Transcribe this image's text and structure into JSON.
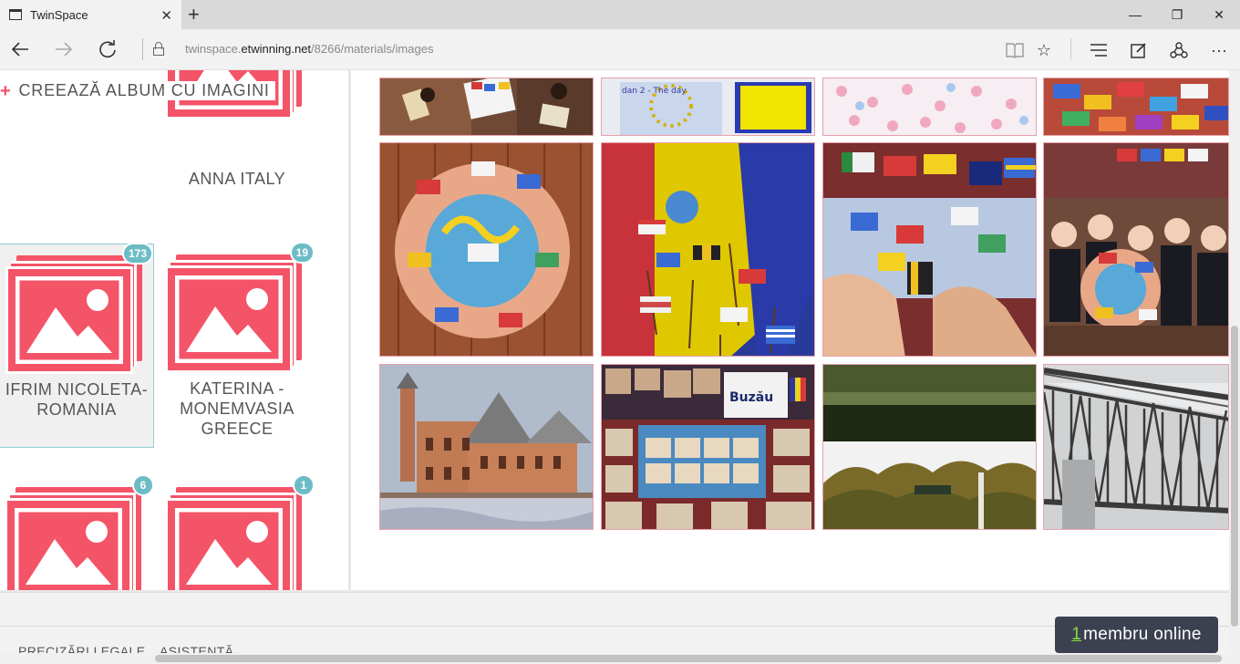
{
  "browser": {
    "tab_title": "TwinSpace",
    "url_prefix": "twinspace.",
    "url_host": "etwinning.net",
    "url_path": "/8266/materials/images",
    "icons": [
      "tab-icon",
      "close-icon",
      "new-tab-icon",
      "minimize-icon",
      "maximize-icon",
      "close-window-icon",
      "back-icon",
      "forward-icon",
      "refresh-icon",
      "lock-icon",
      "reading-view-icon",
      "favorite-star-icon",
      "hub-icon",
      "web-note-icon",
      "share-icon",
      "more-icon"
    ]
  },
  "sidebar": {
    "create_album_label": "CREEAZĂ ALBUM CU IMAGINI",
    "albums": [
      {
        "title": "ANNA ITALY",
        "count": ""
      },
      {
        "title": "IFRIM NICOLETA-ROMANIA",
        "count": "173",
        "selected": true
      },
      {
        "title": "KATERINA - MONEMVASIA GREECE",
        "count": "19"
      },
      {
        "title": "",
        "count": "6"
      },
      {
        "title": "",
        "count": "1"
      }
    ]
  },
  "gallery": {
    "photos": [
      {
        "name": "students-classroom",
        "color": "#7a4a36"
      },
      {
        "name": "eu-flag-drawing",
        "color": "#c9d6e8"
      },
      {
        "name": "hearts-poster",
        "color": "#f3dce6"
      },
      {
        "name": "hands-flags-collage",
        "color": "#c4563e"
      },
      {
        "name": "hands-globe-flags",
        "color": "#9a4a30"
      },
      {
        "name": "flags-on-romanian-flag",
        "color": "#d8c21c"
      },
      {
        "name": "flags-board-hands",
        "color": "#7a2e2e"
      },
      {
        "name": "students-with-flags",
        "color": "#6e4a3a"
      },
      {
        "name": "communal-palace-buzau",
        "color": "#b07a5a"
      },
      {
        "name": "buzau-poster",
        "color": "#3a6a9a"
      },
      {
        "name": "park-lake",
        "color": "#3a4a26"
      },
      {
        "name": "metal-bridge",
        "color": "#5a5a5a"
      }
    ],
    "poster_label": "Buzău"
  },
  "footer": {
    "legal_label": "PRECIZĂRI LEGALE",
    "help_label": "ASISTENȚĂ"
  },
  "online": {
    "count": "1",
    "label": "membru online"
  },
  "colors": {
    "accent": "#f45468",
    "badge": "#6cbcc6",
    "online_bg": "#3c4150",
    "online_count": "#8cdc3c"
  }
}
